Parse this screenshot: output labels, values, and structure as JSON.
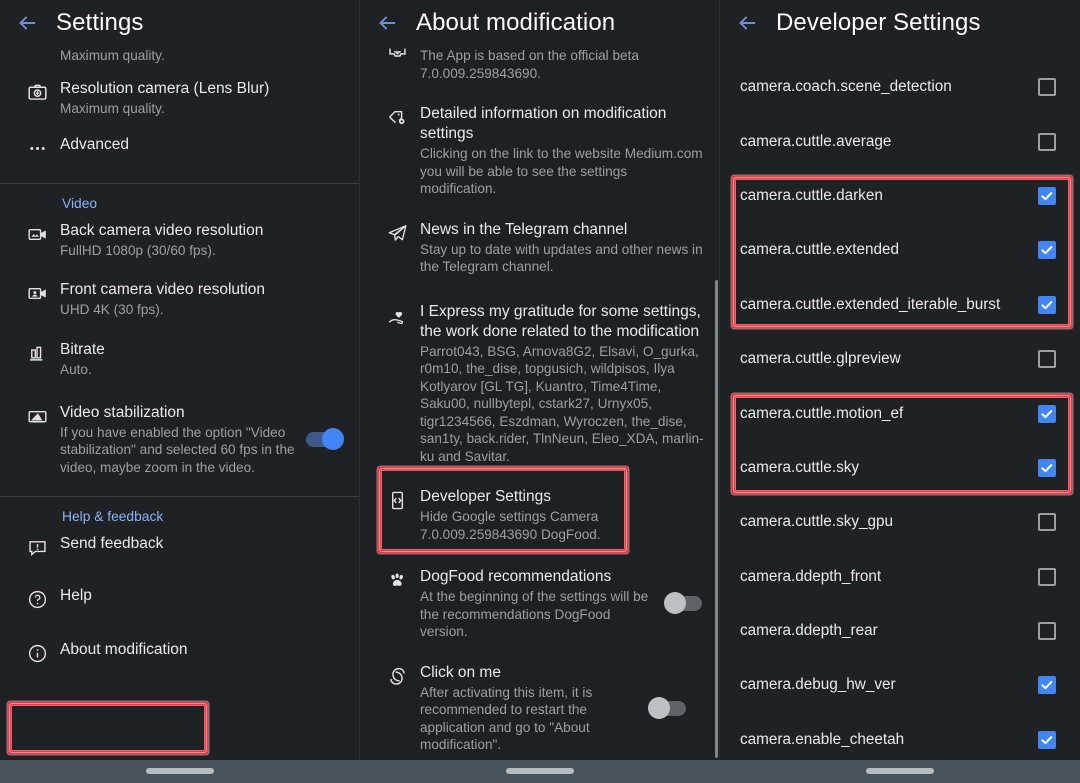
{
  "panel1": {
    "title": "Settings",
    "back_icon": "back-arrow-icon",
    "items_top": [
      {
        "sub": "Maximum quality.",
        "icon": "none"
      },
      {
        "title": "Resolution camera (Lens Blur)",
        "sub": "Maximum quality.",
        "icon": "camera-icon"
      },
      {
        "title": "Advanced",
        "sub": "",
        "icon": "more-horizontal-icon"
      }
    ],
    "section_video": "Video",
    "items_video": [
      {
        "title": "Back camera video resolution",
        "sub": "FullHD 1080p (30/60 fps).",
        "icon": "video-camera-icon"
      },
      {
        "title": "Front camera video resolution",
        "sub": "UHD 4K (30 fps).",
        "icon": "video-camera-front-icon"
      },
      {
        "title": "Bitrate",
        "sub": "Auto.",
        "icon": "bar-chart-icon"
      },
      {
        "title": "Video stabilization",
        "sub": "If you have enabled the option \"Video stabilization\" and selected 60 fps in the video, maybe zoom in the video.",
        "icon": "stabilization-icon",
        "toggle": "on"
      }
    ],
    "section_help": "Help & feedback",
    "items_help": [
      {
        "title": "Send feedback",
        "icon": "feedback-icon"
      },
      {
        "title": "Help",
        "icon": "help-circle-icon"
      },
      {
        "title": "About modification",
        "icon": "info-circle-icon",
        "highlighted": true
      }
    ]
  },
  "panel2": {
    "title": "About modification",
    "back_icon": "back-arrow-icon",
    "items": [
      {
        "title": "",
        "sub": "The App is based on the official beta 7.0.009.259843690.",
        "icon": "inbox-icon"
      },
      {
        "title": "Detailed information on modification settings",
        "sub": "Clicking on the link to the website Medium.com you will be able to see the settings modification.",
        "icon": "tag-gear-icon"
      },
      {
        "title": "News in the Telegram channel",
        "sub": "Stay up to date with updates and other news in the Telegram channel.",
        "icon": "telegram-icon"
      },
      {
        "title": "I Express my gratitude for some settings, the work done related to the modification",
        "sub": "Parrot043, BSG, Arnova8G2, Elsavi, O_gurka, r0m10, the_dise, topgusich, wildpisos, Ilya Kotlyarov [GL TG], Kuantro, Time4Time, Saku00, nullbytepl, cstark27, Urnyx05, tigr1234566, Eszdman, Wyroczen, the_dise, san1ty, back.rider, TlnNeun, Eleo_XDA, marlin-ku and Savitar.",
        "icon": "hand-heart-icon"
      },
      {
        "title": "Developer Settings",
        "sub": "Hide Google settings Camera 7.0.009.259843690 DogFood.",
        "icon": "developer-mode-icon",
        "highlighted": true
      },
      {
        "title": "DogFood recommendations",
        "sub": "At the beginning of the settings will be the recommendations DogFood version.",
        "icon": "paw-icon",
        "toggle": "off"
      },
      {
        "title": "Click on me",
        "sub": "After activating this item, it is recommended to restart the application and go to \"About modification\".",
        "icon": "spiral-icon",
        "toggle": "off"
      }
    ]
  },
  "panel3": {
    "title": "Developer Settings",
    "back_icon": "back-arrow-icon",
    "flags": [
      {
        "name": "camera.coach.scene_detection",
        "checked": false
      },
      {
        "name": "camera.cuttle.average",
        "checked": false
      },
      {
        "name": "camera.cuttle.darken",
        "checked": true
      },
      {
        "name": "camera.cuttle.extended",
        "checked": true
      },
      {
        "name": "camera.cuttle.extended_iterable_burst",
        "checked": true
      },
      {
        "name": "camera.cuttle.glpreview",
        "checked": false
      },
      {
        "name": "camera.cuttle.motion_ef",
        "checked": true
      },
      {
        "name": "camera.cuttle.sky",
        "checked": true
      },
      {
        "name": "camera.cuttle.sky_gpu",
        "checked": false
      },
      {
        "name": "camera.ddepth_front",
        "checked": false
      },
      {
        "name": "camera.ddepth_rear",
        "checked": false
      },
      {
        "name": "camera.debug_hw_ver",
        "checked": true
      },
      {
        "name": "camera.enable_cheetah",
        "checked": true
      }
    ]
  },
  "colors": {
    "accent_blue": "#8ab4f8",
    "checkbox_blue": "#4285f4",
    "highlight_red": "#f2373f",
    "background": "#202124",
    "navbar": "#49535b"
  }
}
